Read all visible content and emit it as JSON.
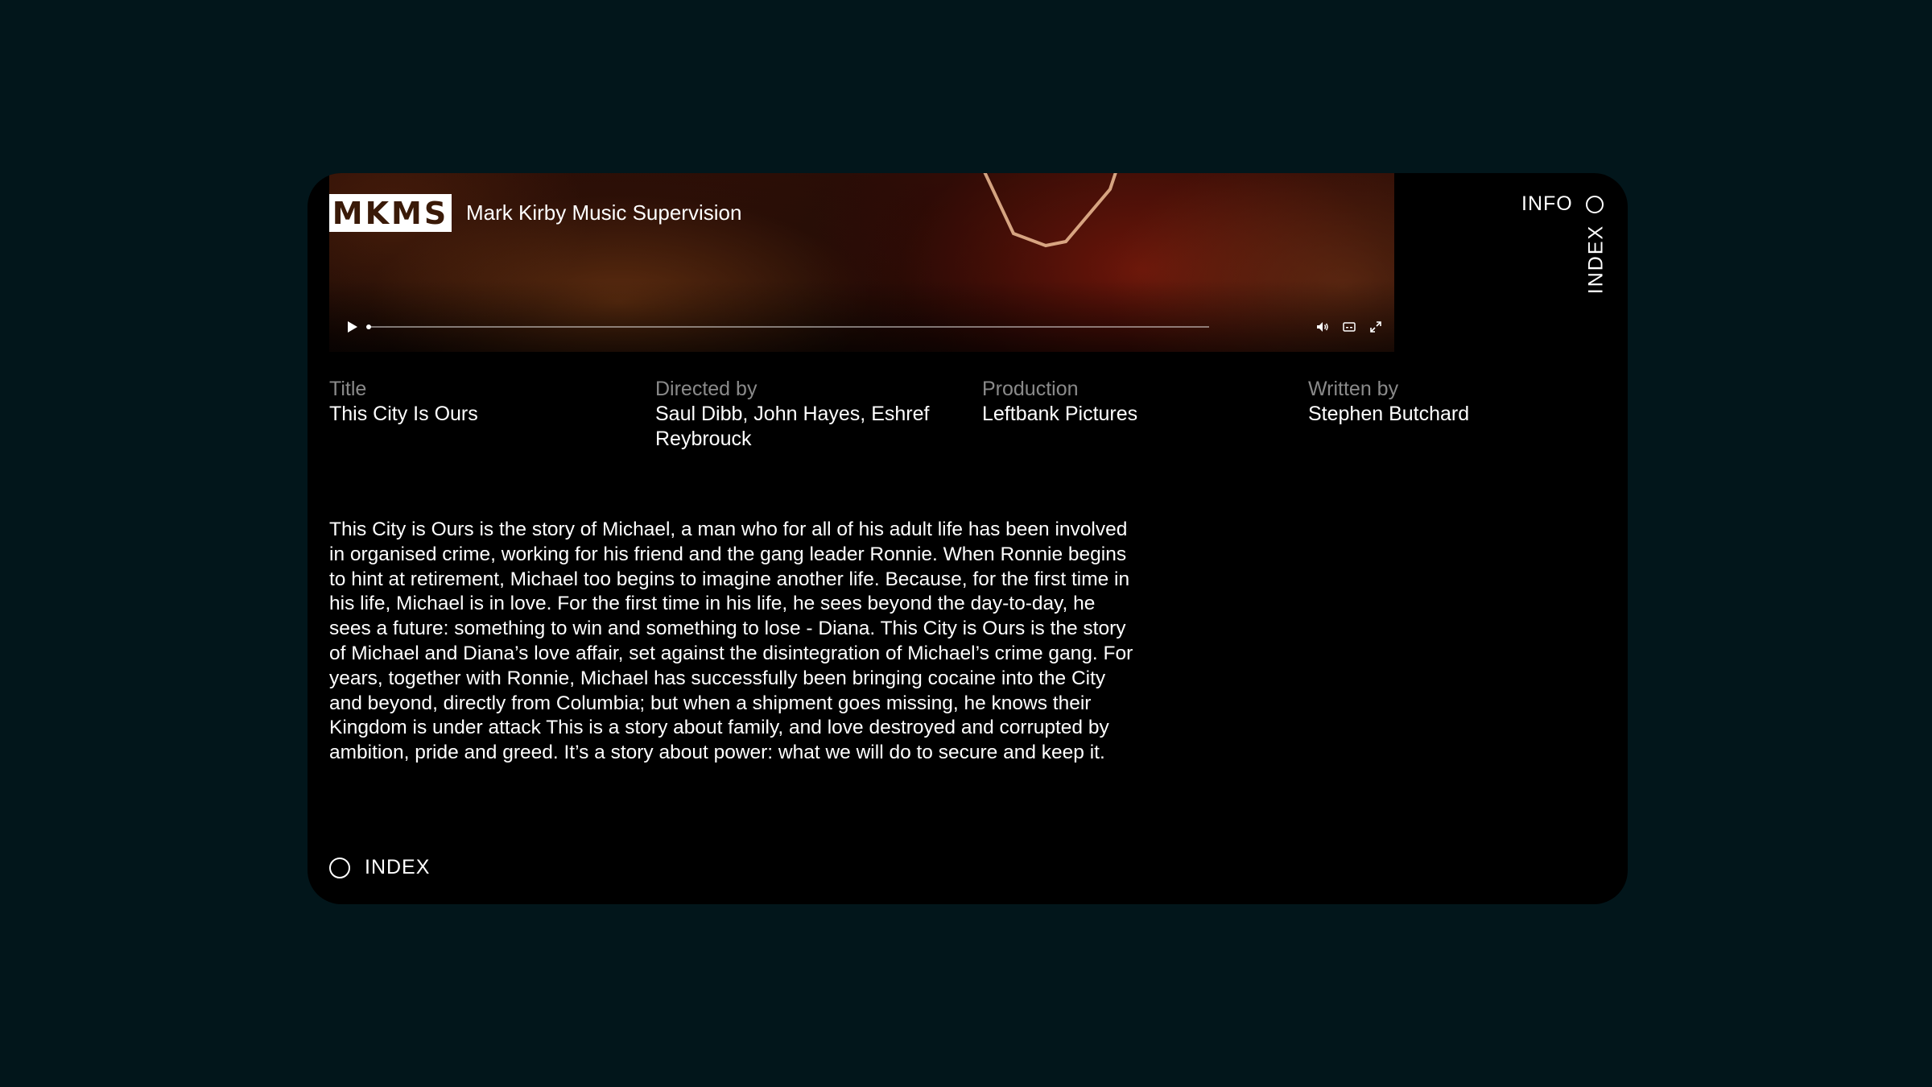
{
  "brand": {
    "logo_text": "MKMS",
    "name": "Mark Kirby Music Supervision"
  },
  "nav": {
    "info_label": "INFO",
    "index_label": "INDEX"
  },
  "video": {
    "progress": 0,
    "icons": [
      "play-icon",
      "volume-icon",
      "captions-icon",
      "fullscreen-icon"
    ]
  },
  "meta": [
    {
      "label": "Title",
      "value": "This City Is Ours"
    },
    {
      "label": "Directed by",
      "value": "Saul Dibb, John Hayes, Eshref Reybrouck"
    },
    {
      "label": "Production",
      "value": "Leftbank Pictures"
    },
    {
      "label": "Written by",
      "value": "Stephen Butchard"
    }
  ],
  "synopsis": "This City is Ours is the story of Michael, a man who for all of his adult life has been involved in organised crime, working for his friend and the gang leader Ronnie. When Ronnie begins to hint at retirement, Michael too begins to imagine another life. Because, for the first time in his life, Michael is in love. For the first time in his life, he sees beyond the day-to-day, he sees a future: something to win and something to lose - Diana. This City is Ours is the story of Michael and Diana’s love affair, set against the disintegration of Michael’s crime gang. For years, together with Ronnie, Michael has successfully been bringing cocaine into the City and beyond, directly from Columbia; but when a shipment goes missing, he knows their Kingdom is under attack This is a story about family, and love destroyed and corrupted by ambition, pride and greed. It’s a story about power: what we will do to secure and keep it.",
  "footer": {
    "index_label": "INDEX"
  },
  "colors": {
    "page_background": "#02161b",
    "panel_background": "#000000",
    "label_gray": "#8a8a8a",
    "logo_text": "#3a1a08"
  }
}
